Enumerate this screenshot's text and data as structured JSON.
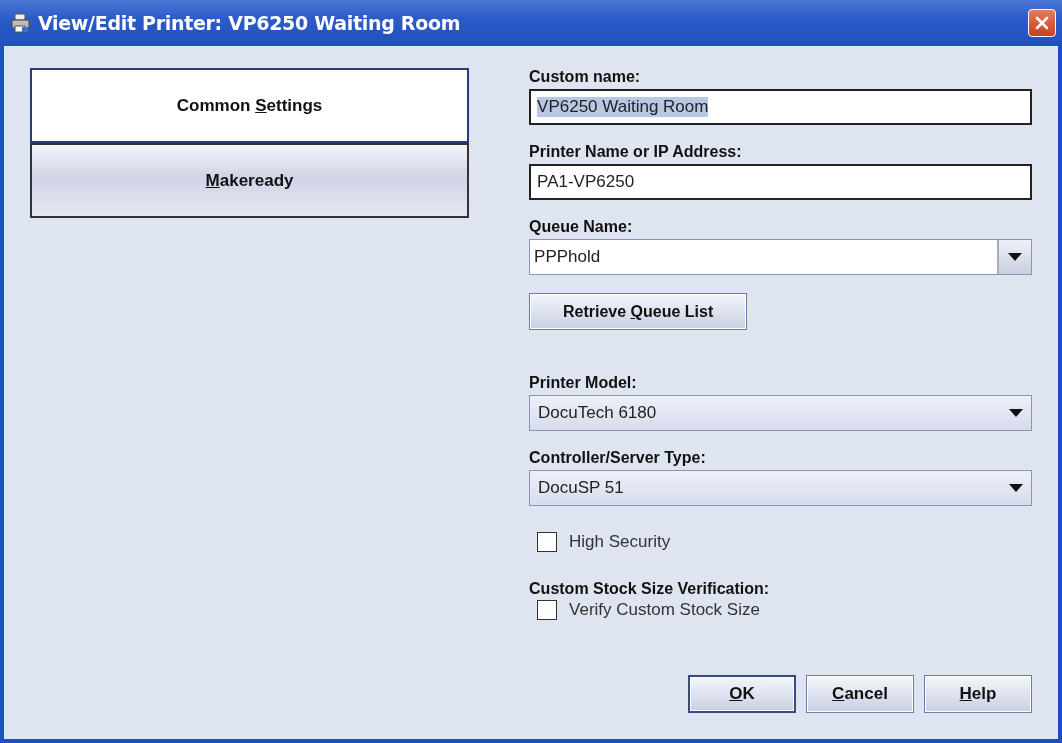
{
  "window": {
    "title": "View/Edit Printer: VP6250 Waiting Room"
  },
  "nav": [
    {
      "label_start": "Common ",
      "mnemonic": "S",
      "label_end": "ettings",
      "selected": true
    },
    {
      "mnemonic": "M",
      "label_end": "akeready",
      "selected": false
    }
  ],
  "fields": [
    {
      "kind": "text",
      "label": "Custom name:",
      "value": "VP6250 Waiting Room",
      "text_selected": true
    },
    {
      "kind": "text",
      "label": "Printer Name or IP Address:",
      "value": "PA1-VP6250",
      "text_selected": false
    },
    {
      "kind": "editable-combo",
      "label": "Queue Name:",
      "value": "PPPhold"
    },
    {
      "kind": "button",
      "label_start": "Retrieve ",
      "mnemonic": "Q",
      "label_end": "ueue List"
    },
    {
      "kind": "combo",
      "label": "Printer Model:",
      "value": "DocuTech 6180"
    },
    {
      "kind": "combo",
      "label": "Controller/Server Type:",
      "value": "DocuSP 51"
    },
    {
      "kind": "checkbox",
      "label": "High Security",
      "checked": false
    },
    {
      "kind": "heading",
      "label": "Custom Stock Size Verification:"
    },
    {
      "kind": "checkbox",
      "label": "Verify Custom Stock Size",
      "checked": false
    }
  ],
  "buttons": [
    {
      "mnemonic": "O",
      "label_end": "K",
      "default": true
    },
    {
      "mnemonic": "C",
      "label_end": "ancel",
      "default": false
    },
    {
      "mnemonic": "H",
      "label_end": "elp",
      "default": false
    }
  ]
}
